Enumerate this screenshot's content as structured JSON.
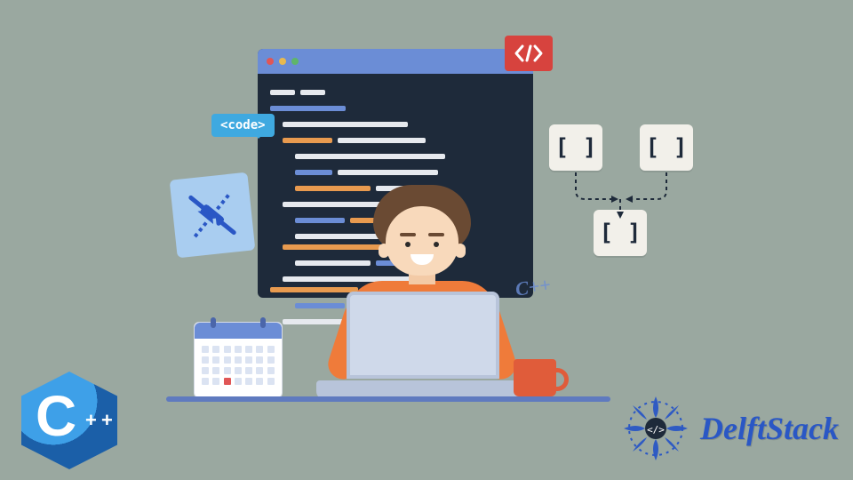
{
  "badges": {
    "code_bubble": "<code>",
    "code_slash": "</>",
    "cpp_float": "C++"
  },
  "brackets": {
    "top_left": "[ ]",
    "top_right": "[ ]",
    "bottom": "[ ]"
  },
  "logos": {
    "cpp_letter": "C",
    "cpp_plus": "+",
    "delftstack": "DelftStack"
  },
  "colors": {
    "bg": "#9aa8a0",
    "editor_bg": "#1e2a3a",
    "editor_bar": "#6b8dd6",
    "accent_red": "#d7433e",
    "accent_cyan": "#3fa9e0",
    "accent_orange": "#ef7b3a",
    "brand_blue": "#2a57c5"
  }
}
